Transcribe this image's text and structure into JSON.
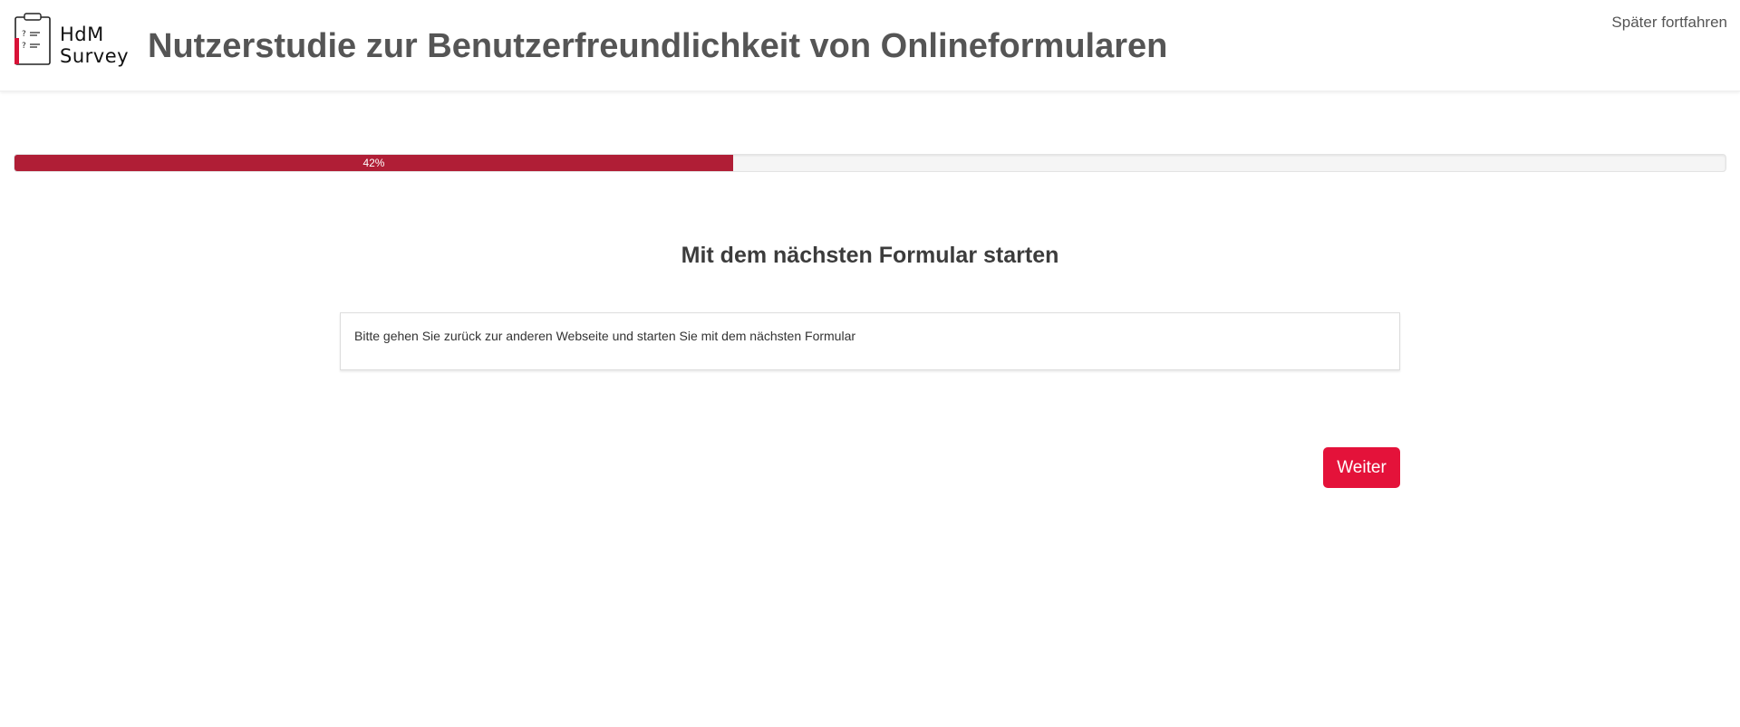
{
  "header": {
    "logo_line1": "HdM",
    "logo_line2": "Survey",
    "title": "Nutzerstudie zur Benutzerfreundlichkeit von Onlineformularen",
    "later_link": "Später fortfahren"
  },
  "progress": {
    "percent": 42,
    "label": "42%"
  },
  "main": {
    "heading": "Mit dem nächsten Formular starten",
    "message": "Bitte gehen Sie zurück zur anderen Webseite und starten Sie mit dem nächsten Formular",
    "next_button": "Weiter"
  },
  "icons": {
    "logo": "clipboard-icon"
  },
  "colors": {
    "accent": "#e4123a",
    "progress": "#b01e36",
    "title": "#555555"
  }
}
